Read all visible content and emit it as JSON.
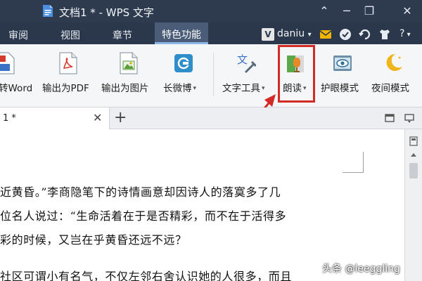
{
  "window": {
    "title": "文档1 * - WPS 文字",
    "minimize_glyph": "─",
    "restore_glyph": "❐",
    "close_glyph": "✕",
    "collapse_glyph": "⌃"
  },
  "menubar": {
    "items": [
      "审阅",
      "视图",
      "章节",
      "特色功能"
    ],
    "active": "特色功能",
    "user_badge": "V",
    "user_name": "daniu",
    "user_dropdown": "▾",
    "help": "?"
  },
  "ribbon": {
    "buttons": [
      {
        "label": "转Word",
        "icon": "to-word-icon"
      },
      {
        "label": "输出为PDF",
        "icon": "pdf-export-icon"
      },
      {
        "label": "输出为图片",
        "icon": "image-export-icon"
      },
      {
        "label": "长微博",
        "icon": "weibo-icon",
        "dropdown": true
      },
      {
        "label": "文字工具",
        "icon": "text-tools-icon",
        "dropdown": true
      },
      {
        "label": "朗读",
        "icon": "read-aloud-icon",
        "dropdown": true
      },
      {
        "label": "护眼模式",
        "icon": "eye-protect-icon"
      },
      {
        "label": "夜间模式",
        "icon": "night-mode-icon"
      }
    ],
    "dropdown_glyph": "▾"
  },
  "tabs": {
    "doc_tab": "1 *",
    "close": "✕",
    "new": "+"
  },
  "document": {
    "lines": [
      "近黄昏。”李商隐笔下的诗情画意却因诗人的落寞多了几",
      "位名人说过：“生命活着在于是否精彩，而不在于活得多",
      "彩的时候，又岂在乎黄昏还远不远？",
      "社区可谓小有名气，不仅左邻右舍认识她的人很多，而且"
    ]
  },
  "watermark": "头条 @leeggling",
  "colors": {
    "titlebar": "#2e3b4f",
    "menubar": "#2b384c",
    "active_tab": "#4a5c78",
    "highlight": "#d42a26"
  }
}
